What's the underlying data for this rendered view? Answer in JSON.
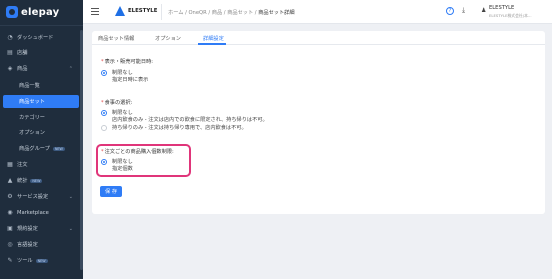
{
  "app": {
    "logo_text": "elepay"
  },
  "sidebar": {
    "items": [
      {
        "label": "ダッシュボード",
        "icon": "dashboard-icon"
      },
      {
        "label": "店舗",
        "icon": "store-icon"
      },
      {
        "label": "商品",
        "icon": "tag-icon"
      },
      {
        "label": "商品一覧"
      },
      {
        "label": "商品セット"
      },
      {
        "label": "カテゴリー"
      },
      {
        "label": "オプション"
      },
      {
        "label": "商品グループ",
        "badge": "NEW"
      },
      {
        "label": "注文",
        "icon": "order-icon"
      },
      {
        "label": "統計",
        "icon": "chart-icon",
        "badge": "NEW"
      },
      {
        "label": "サービス設定",
        "icon": "settings-icon"
      },
      {
        "label": "Marketplace",
        "icon": "marketplace-icon"
      },
      {
        "label": "規約設定",
        "icon": "doc-icon"
      },
      {
        "label": "言語設定",
        "icon": "language-icon"
      },
      {
        "label": "ツール",
        "icon": "tool-icon",
        "badge": "NEW"
      }
    ]
  },
  "header": {
    "brand": "ELESTYLE",
    "breadcrumbs": [
      "ホーム",
      "OneQR",
      "商品",
      "商品セット",
      "商品セット詳細"
    ],
    "help": "?",
    "user_name": "ELESTYLE",
    "user_sub": "ELESTYLE株式会社(本..."
  },
  "tabs": [
    "商品セット情報",
    "オプション",
    "詳細設定"
  ],
  "form": {
    "sections": [
      {
        "label": "表示・販売可能日時:",
        "options": [
          "制限なし",
          "指定日時に表示"
        ],
        "selected": 0
      },
      {
        "label": "食事の選択:",
        "options": [
          "制限なし",
          "店内飲食のみ - 注文は店内での飲食に限定され、持ち帰りは不可。",
          "持ち帰りのみ - 注文は持ち帰り専用で、店内飲食は不可。"
        ],
        "selected": 0
      },
      {
        "label": "注文ごとの商品購入個数制限:",
        "options": [
          "制限なし",
          "指定個数"
        ],
        "selected": 0
      }
    ],
    "required_mark": "*",
    "save_label": "保 存"
  },
  "colors": {
    "accent": "#2f7cf6",
    "sidebar_bg": "#1f2d3d",
    "highlight": "#e0357a"
  }
}
